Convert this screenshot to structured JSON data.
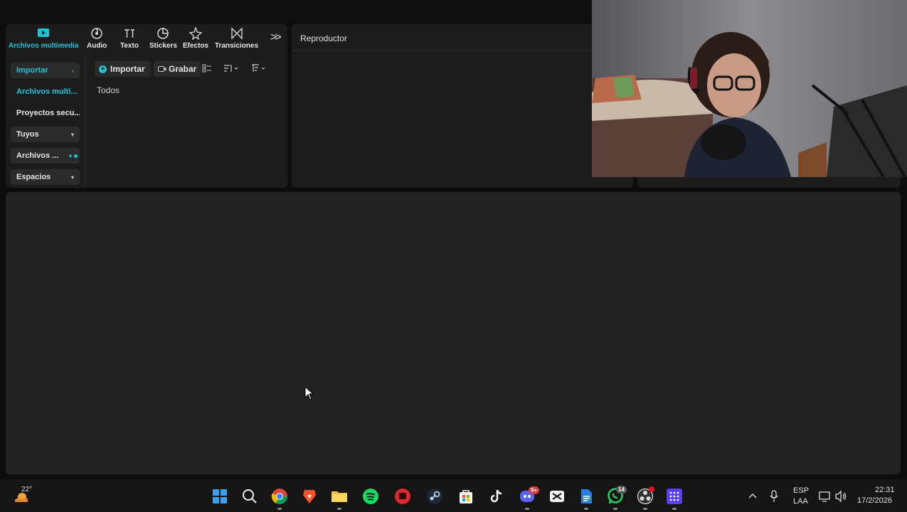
{
  "app": {
    "accent": "#1dc4d6",
    "toolbar": [
      {
        "label": "Archivos multimedia",
        "icon": "media-play-icon",
        "active": true
      },
      {
        "label": "Audio",
        "icon": "audio-disc-icon"
      },
      {
        "label": "Texto",
        "icon": "text-ti-icon"
      },
      {
        "label": "Stickers",
        "icon": "sticker-icon"
      },
      {
        "label": "Efectos",
        "icon": "effects-star-icon"
      },
      {
        "label": "Transiciones",
        "icon": "transitions-bowtie-icon"
      }
    ],
    "more_tools": ">>",
    "sidebar": [
      {
        "label": "Importar",
        "style": "box-teal"
      },
      {
        "label": "Archivos multi...",
        "style": "teal"
      },
      {
        "label": "Proyectos secu...",
        "style": "plain"
      },
      {
        "label": "Tuyos",
        "style": "box"
      },
      {
        "label": "Archivos ...",
        "style": "box"
      },
      {
        "label": "Espacios",
        "style": "box"
      }
    ],
    "import_button": "Importar",
    "record_button": "Grabar",
    "filter_label": "Todos",
    "player_title": "Reproductor"
  },
  "taskbar": {
    "weather_temp": "22°",
    "apps": [
      {
        "name": "windows-start-icon"
      },
      {
        "name": "search-icon"
      },
      {
        "name": "chrome-icon"
      },
      {
        "name": "brave-icon"
      },
      {
        "name": "file-explorer-icon"
      },
      {
        "name": "spotify-icon"
      },
      {
        "name": "red-app-icon"
      },
      {
        "name": "steam-icon"
      },
      {
        "name": "microsoft-store-icon"
      },
      {
        "name": "tiktok-icon"
      },
      {
        "name": "discord-icon",
        "badge": "9+"
      },
      {
        "name": "capcut-icon"
      },
      {
        "name": "docs-icon"
      },
      {
        "name": "whatsapp-icon",
        "badge": "14"
      },
      {
        "name": "obs-icon"
      },
      {
        "name": "grid-app-icon"
      }
    ],
    "tray": {
      "lang_top": "ESP",
      "lang_bottom": "LAA",
      "time": "22:31",
      "date": "17/2/2026"
    }
  }
}
